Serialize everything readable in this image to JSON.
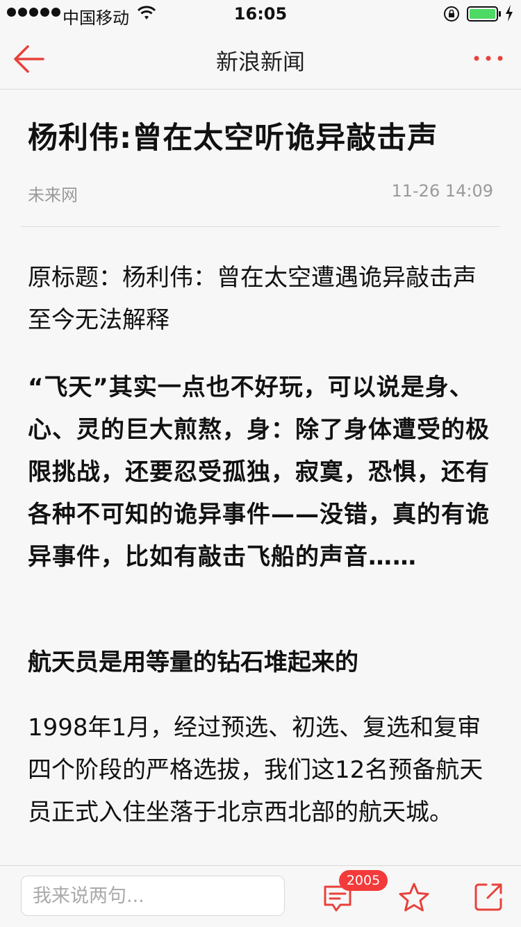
{
  "status_bar": {
    "carrier": "中国移动",
    "time": "16:05"
  },
  "nav": {
    "title": "新浪新闻",
    "back_icon": "back-arrow-icon",
    "more_icon": "more-dots-icon",
    "accent_color": "#e8413b"
  },
  "article": {
    "headline": "杨利伟:曾在太空听诡异敲击声",
    "source": "未来网",
    "timestamp": "11-26 14:09",
    "paragraphs": {
      "original_title": "原标题：杨利伟：曾在太空遭遇诡异敲击声 至今无法解释",
      "lead": "“飞天”其实一点也不好玩，可以说是身、心、灵的巨大煎熬，身：除了身体遭受的极限挑战，还要忍受孤独，寂寞，恐惧，还有各种不可知的诡异事件——没错，真的有诡异事件，比如有敲击飞船的声音……",
      "subheading": "航天员是用等量的钻石堆起来的",
      "body": "1998年1月，经过预选、初选、复选和复审四个阶段的严格选拔，我们这12名预备航天员正式入住坐落于北京西北部的航天城。"
    }
  },
  "bottom_bar": {
    "comment_placeholder": "我来说两句...",
    "comment_count": "2005",
    "comment_icon": "comment-icon",
    "favorite_icon": "star-icon",
    "share_icon": "share-icon"
  }
}
